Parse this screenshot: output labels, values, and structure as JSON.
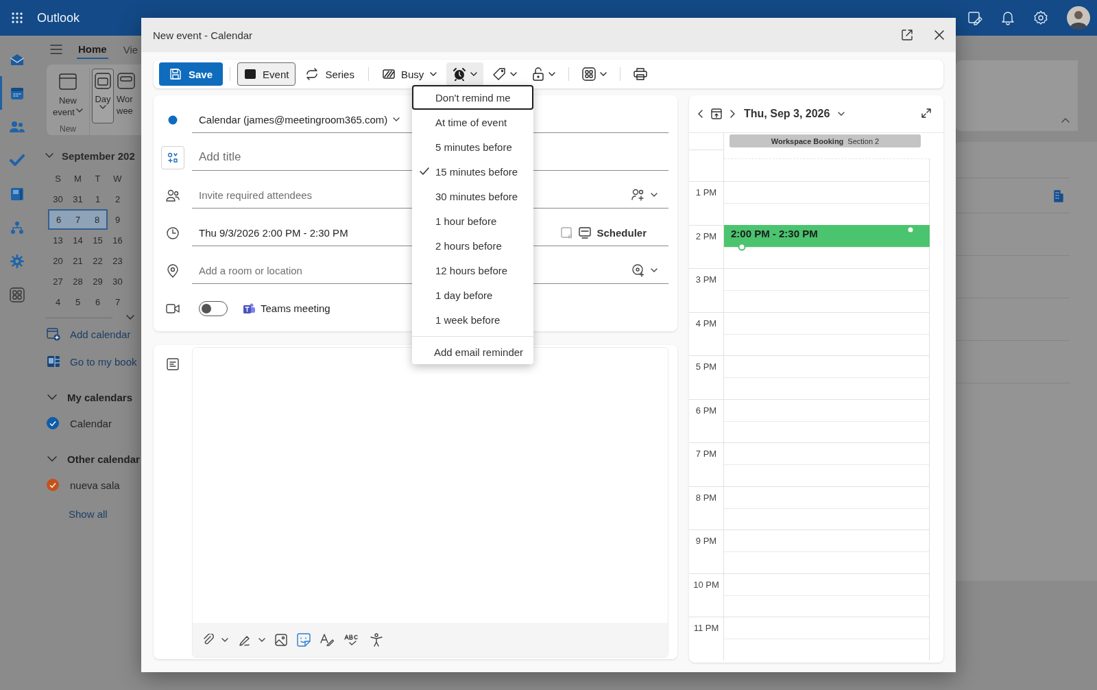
{
  "app": {
    "name": "Outlook",
    "rail": [
      {
        "kind": "mail",
        "selected": false
      },
      {
        "kind": "calendar",
        "selected": true
      },
      {
        "kind": "people",
        "selected": false
      },
      {
        "kind": "todo",
        "selected": false
      },
      {
        "kind": "bookings",
        "selected": false
      },
      {
        "kind": "org",
        "selected": false
      },
      {
        "kind": "addin",
        "selected": false
      },
      {
        "kind": "apps",
        "selected": false
      }
    ],
    "tabs": [
      {
        "label": "Home",
        "selected": true
      },
      {
        "label": "Vie",
        "selected": false
      }
    ],
    "ribbon": {
      "buttons": [
        {
          "kind": "new",
          "lines": [
            "New",
            "event"
          ],
          "selected": false
        },
        {
          "kind": "day",
          "lines": [
            "Day"
          ],
          "selected": true
        },
        {
          "kind": "week",
          "lines": [
            "Wor",
            "wee"
          ],
          "selected": false
        }
      ],
      "group_label": "New"
    },
    "mini_calendar": {
      "month": "September 202",
      "weekdays": [
        "S",
        "M",
        "T",
        "W"
      ],
      "weeks": [
        [
          {
            "day": "30",
            "selected": false
          },
          {
            "day": "31",
            "selected": false
          },
          {
            "day": "1",
            "selected": false
          },
          {
            "day": "2",
            "selected": false
          }
        ],
        [
          {
            "day": "6",
            "selected": true
          },
          {
            "day": "7",
            "selected": true
          },
          {
            "day": "8",
            "selected": true
          },
          {
            "day": "9",
            "selected": false
          }
        ],
        [
          {
            "day": "13",
            "selected": false
          },
          {
            "day": "14",
            "selected": false
          },
          {
            "day": "15",
            "selected": false
          },
          {
            "day": "16",
            "selected": false
          }
        ],
        [
          {
            "day": "20",
            "selected": false
          },
          {
            "day": "21",
            "selected": false
          },
          {
            "day": "22",
            "selected": false
          },
          {
            "day": "23",
            "selected": false
          }
        ],
        [
          {
            "day": "27",
            "selected": false
          },
          {
            "day": "28",
            "selected": false
          },
          {
            "day": "29",
            "selected": false
          },
          {
            "day": "30",
            "selected": false
          }
        ],
        [
          {
            "day": "4",
            "selected": false
          },
          {
            "day": "5",
            "selected": false
          },
          {
            "day": "6",
            "selected": false
          },
          {
            "day": "7",
            "selected": false
          }
        ]
      ]
    },
    "links": [
      {
        "kind": "add-calendar",
        "label": "Add calendar"
      },
      {
        "kind": "bookings",
        "label": "Go to my book"
      }
    ],
    "calendar_groups": [
      {
        "title": "My calendars",
        "expanded": true,
        "items": [
          {
            "label": "Calendar",
            "checked": true,
            "color": "#0f5ca8"
          }
        ]
      },
      {
        "title": "Other calendar",
        "expanded": true,
        "items": [
          {
            "label": "nueva sala",
            "checked": true,
            "color": "#c4521c"
          }
        ]
      }
    ],
    "show_all": "Show all"
  },
  "dialog": {
    "title": "New event - Calendar",
    "toolbar": [
      {
        "kind": "save",
        "label": "Save"
      },
      {
        "kind": "divider"
      },
      {
        "kind": "event",
        "label": "Event",
        "selected": true
      },
      {
        "kind": "series",
        "label": "Series",
        "selected": false
      },
      {
        "kind": "divider"
      },
      {
        "kind": "busy",
        "label": "Busy"
      },
      {
        "kind": "reminder",
        "expanded": true
      },
      {
        "kind": "category",
        "expanded": false
      },
      {
        "kind": "privacy",
        "expanded": false
      },
      {
        "kind": "divider"
      },
      {
        "kind": "apps",
        "expanded": false
      },
      {
        "kind": "divider"
      },
      {
        "kind": "print"
      }
    ],
    "form": {
      "calendar": {
        "label": "Calendar (james@meetingroom365.com)"
      },
      "title": {
        "placeholder": "Add title"
      },
      "attendees": {
        "placeholder": "Invite required attendees"
      },
      "time": {
        "value": "Thu 9/3/2026 2:00 PM - 2:30 PM",
        "scheduler": "Scheduler"
      },
      "location": {
        "placeholder": "Add a room or location"
      },
      "teams": {
        "label": "Teams meeting",
        "on": false
      }
    },
    "reminder_menu": {
      "items": [
        {
          "label": "Don't remind me",
          "selected": false,
          "focused": true
        },
        {
          "label": "At time of event",
          "selected": false,
          "focused": false
        },
        {
          "label": "5 minutes before",
          "selected": false,
          "focused": false
        },
        {
          "label": "15 minutes before",
          "selected": true,
          "focused": false
        },
        {
          "label": "30 minutes before",
          "selected": false,
          "focused": false
        },
        {
          "label": "1 hour before",
          "selected": false,
          "focused": false
        },
        {
          "label": "2 hours before",
          "selected": false,
          "focused": false
        },
        {
          "label": "12 hours before",
          "selected": false,
          "focused": false
        },
        {
          "label": "1 day before",
          "selected": false,
          "focused": false
        },
        {
          "label": "1 week before",
          "selected": false,
          "focused": false
        }
      ],
      "footer": "Add email reminder"
    },
    "day_view": {
      "date": "Thu, Sep 3, 2026",
      "all_day": {
        "title": "Workspace Booking",
        "detail": "Section 2"
      },
      "hours": [
        "1 PM",
        "2 PM",
        "3 PM",
        "4 PM",
        "5 PM",
        "6 PM",
        "7 PM",
        "8 PM",
        "9 PM",
        "10 PM",
        "11 PM"
      ],
      "event": {
        "label": "2:00 PM - 2:30 PM",
        "color": "#4bc46f"
      }
    }
  }
}
